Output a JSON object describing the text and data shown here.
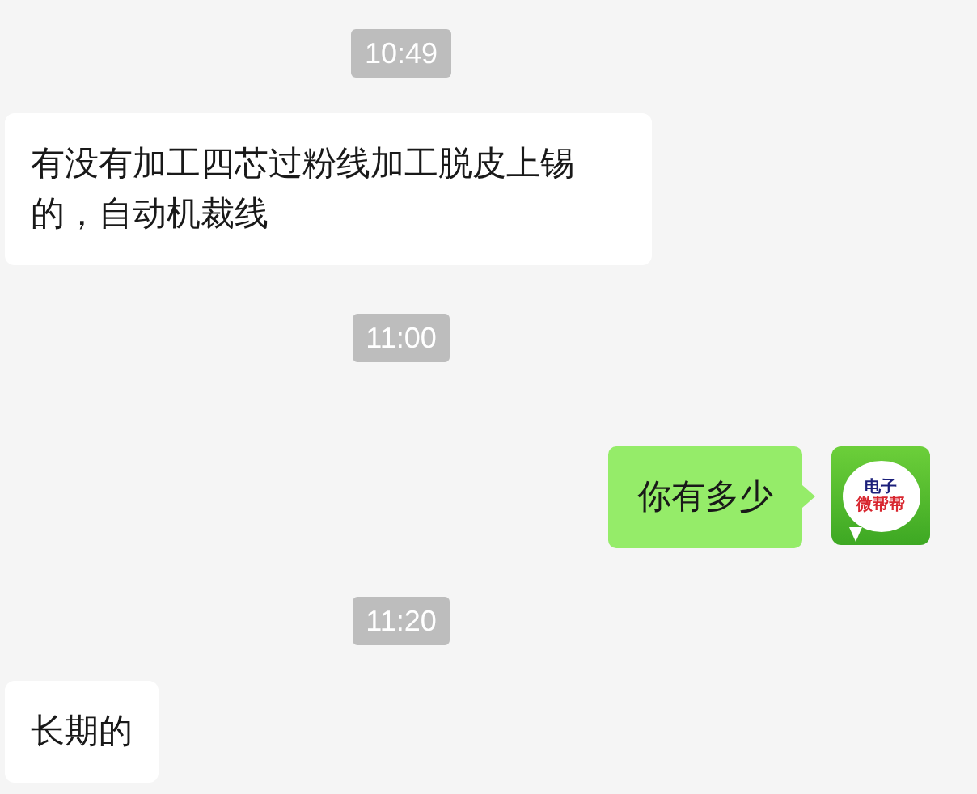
{
  "messages": [
    {
      "kind": "time",
      "text": "10:49"
    },
    {
      "kind": "incoming",
      "text": "有没有加工四芯过粉线加工脱皮上锡的，自动机裁线"
    },
    {
      "kind": "time",
      "text": "11:00"
    },
    {
      "kind": "outgoing",
      "text": "你有多少",
      "avatar": [
        "电子",
        "微帮帮"
      ]
    },
    {
      "kind": "time",
      "text": "11:20"
    },
    {
      "kind": "incoming",
      "text": "长期的"
    }
  ]
}
